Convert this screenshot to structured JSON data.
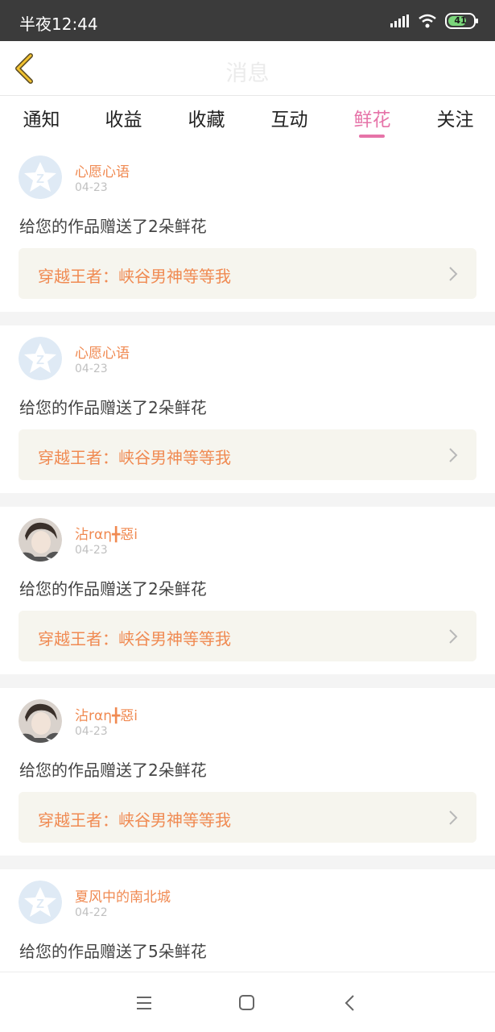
{
  "status_bar": {
    "time": "半夜12:44",
    "battery": "41",
    "icons": [
      "signal-icon",
      "wifi-icon",
      "battery-icon"
    ]
  },
  "header": {
    "title": "消息",
    "back_icon": "chevron-left-icon"
  },
  "tabs": [
    {
      "label": "通知",
      "active": false
    },
    {
      "label": "收益",
      "active": false
    },
    {
      "label": "收藏",
      "active": false
    },
    {
      "label": "互动",
      "active": false
    },
    {
      "label": "鲜花",
      "active": true
    },
    {
      "label": "关注",
      "active": false
    }
  ],
  "messages": [
    {
      "username": "心愿心语",
      "date": "04-23",
      "text": "给您的作品赠送了2朵鲜花",
      "work": "穿越王者：峡谷男神等等我",
      "avatar": "default-avatar"
    },
    {
      "username": "心愿心语",
      "date": "04-23",
      "text": "给您的作品赠送了2朵鲜花",
      "work": "穿越王者：峡谷男神等等我",
      "avatar": "default-avatar"
    },
    {
      "username": "沾rαη╋惡i",
      "date": "04-23",
      "text": "给您的作品赠送了2朵鲜花",
      "work": "穿越王者：峡谷男神等等我",
      "avatar": "photo-avatar"
    },
    {
      "username": "沾rαη╋惡i",
      "date": "04-23",
      "text": "给您的作品赠送了2朵鲜花",
      "work": "穿越王者：峡谷男神等等我",
      "avatar": "photo-avatar"
    },
    {
      "username": "夏风中的南北城",
      "date": "04-22",
      "text": "给您的作品赠送了5朵鲜花",
      "work": "",
      "avatar": "default-avatar"
    }
  ],
  "colors": {
    "accent": "#e673a8",
    "username": "#f08a52",
    "link_bg": "#f6f5ee",
    "status_bar": "#3b3b3b"
  },
  "nav_bar": {
    "icons": [
      "menu-icon",
      "home-icon",
      "back-icon"
    ]
  }
}
